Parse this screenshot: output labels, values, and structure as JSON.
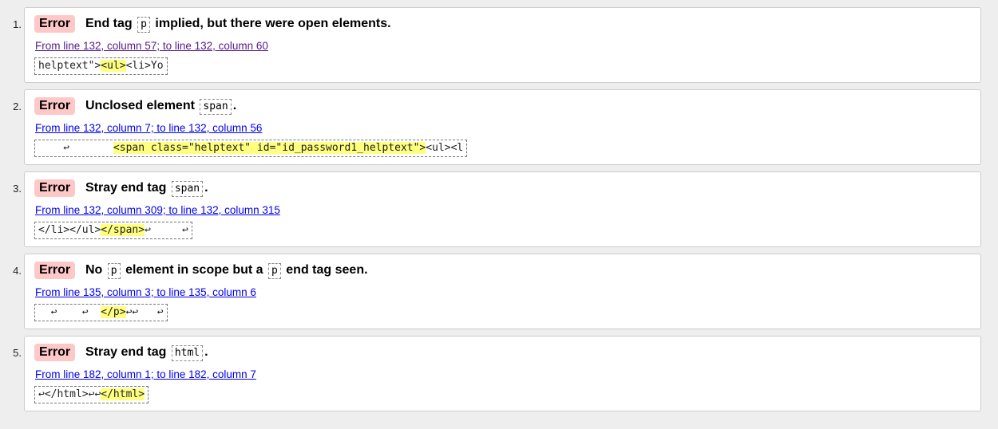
{
  "errors": [
    {
      "number": "1.",
      "badge": "Error",
      "message_parts": [
        "End tag",
        "p",
        "implied, but there were open elements."
      ],
      "location": "From line 132, column 57; to line 132, column 60",
      "extract": {
        "before": "helptext\">",
        "highlight": "<ul>",
        "after": "<li>Yo"
      }
    },
    {
      "number": "2.",
      "badge": "Error",
      "message_parts": [
        "Unclosed element",
        "span",
        "."
      ],
      "location": "From line 132, column 7; to line 132, column 56",
      "extract": {
        "before": "    ↩       ",
        "highlight": "<span class=\"helptext\" id=\"id_password1_helptext\">",
        "after": "<ul><l"
      }
    },
    {
      "number": "3.",
      "badge": "Error",
      "message_parts": [
        "Stray end tag",
        "span",
        "."
      ],
      "location": "From line 132, column 309; to line 132, column 315",
      "extract": {
        "before": "</li></ul>",
        "highlight": "</span>",
        "after": "↩     ↩"
      }
    },
    {
      "number": "4.",
      "badge": "Error",
      "message_parts": [
        "No",
        "p",
        "element in scope but a",
        "p",
        "end tag seen."
      ],
      "location": "From line 135, column 3; to line 135, column 6",
      "extract": {
        "before": "  ↩    ↩  ",
        "highlight": "</p>",
        "after": "↩↩   ↩"
      }
    },
    {
      "number": "5.",
      "badge": "Error",
      "message_parts": [
        "Stray end tag",
        "html",
        "."
      ],
      "location": "From line 182, column 1; to line 182, column 7",
      "extract": {
        "before": "↩</html>↩↩",
        "highlight": "</html>",
        "after": ""
      }
    }
  ]
}
